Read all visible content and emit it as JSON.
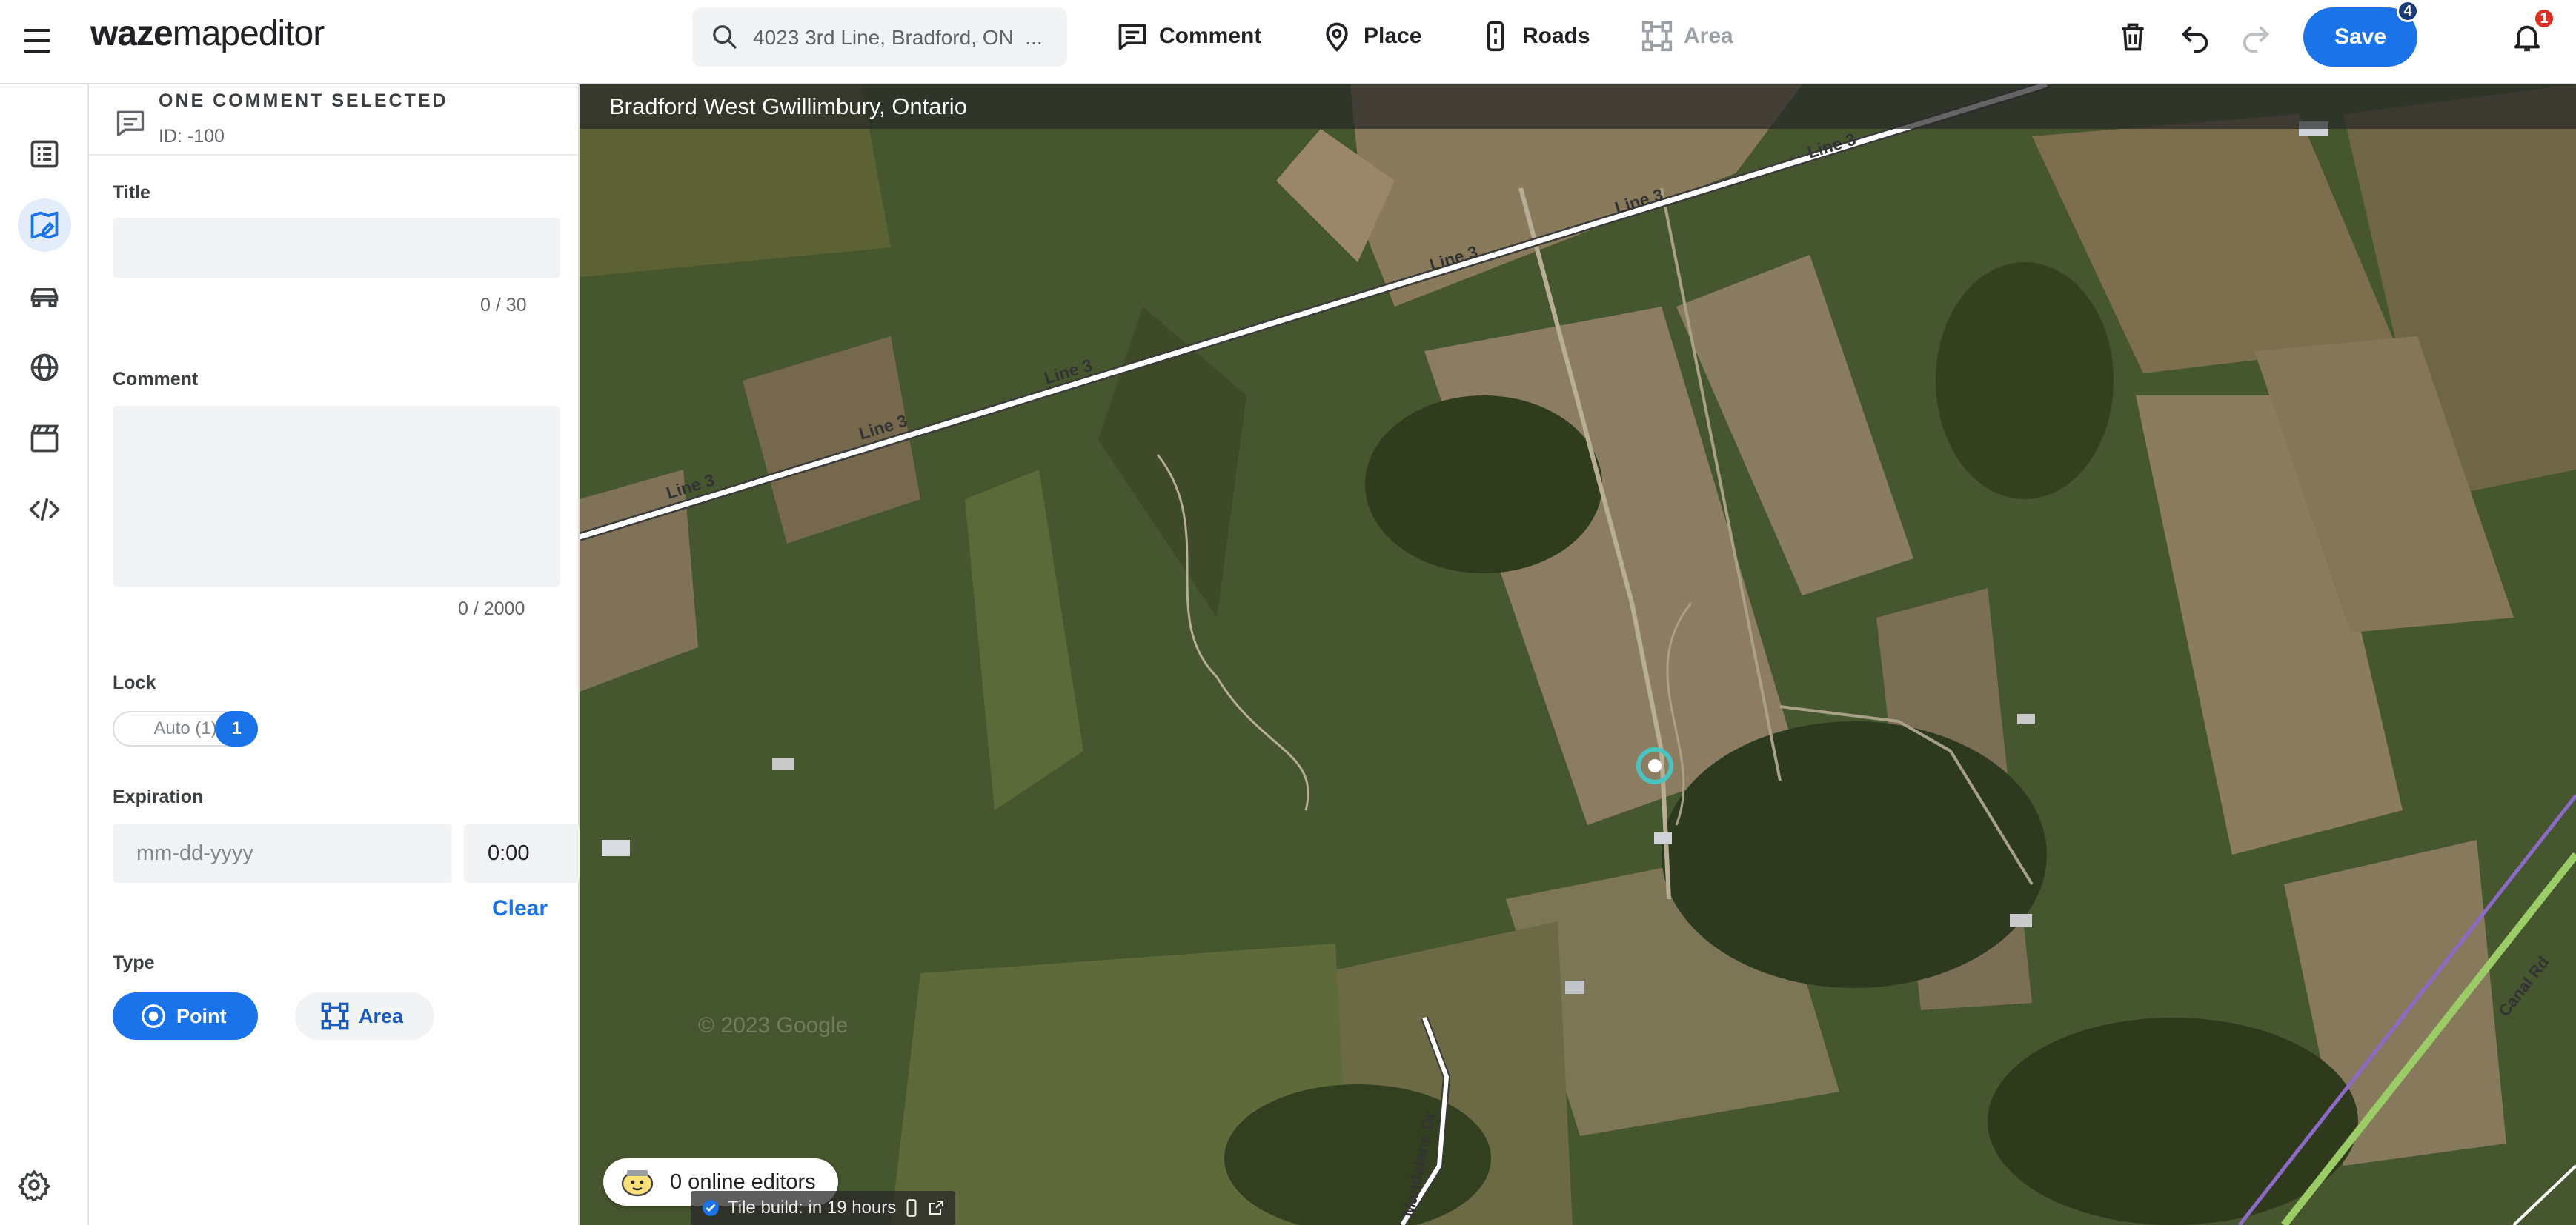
{
  "topbar": {
    "logo_prefix": "waze",
    "logo_suffix": "mapeditor",
    "search_value": "4023 3rd Line, Bradford, ON  ...",
    "tools": {
      "comment": "Comment",
      "place": "Place",
      "roads": "Roads",
      "area": "Area"
    },
    "save_label": "Save",
    "save_badge": "4",
    "notif_badge": "1",
    "accent": "#1a73e8",
    "alert": "#d93025"
  },
  "rail": {
    "icons": [
      "list-icon",
      "map-edit-icon",
      "car-icon",
      "globe-icon",
      "clapperboard-icon",
      "code-icon"
    ],
    "settings_icon": "gear-icon"
  },
  "panel": {
    "header": "ONE COMMENT SELECTED",
    "id_text": "ID: -100",
    "title_label": "Title",
    "title_value": "",
    "title_counter": "0 / 30",
    "comment_label": "Comment",
    "comment_value": "",
    "comment_counter": "0 / 2000",
    "lock_label": "Lock",
    "lock_auto": "Auto (1)",
    "lock_value": "1",
    "expiration_label": "Expiration",
    "date_placeholder": "mm-dd-yyyy",
    "time_value": "0:00",
    "clear_label": "Clear",
    "type_label": "Type",
    "type_point": "Point",
    "type_area": "Area",
    "selected_type": "Point"
  },
  "map": {
    "location": "Bradford West Gwillimbury, Ontario",
    "road_labels": [
      "Line 3",
      "Line 3",
      "Line 3",
      "Line 3",
      "Line 3",
      "Line 3"
    ],
    "road_mandalane": "Mandalane Dr",
    "road_canal": "Canal Rd",
    "watermark": "© 2023 Google",
    "online_editors": "0 online editors",
    "tile_build": "Tile build: in 19 hours"
  }
}
